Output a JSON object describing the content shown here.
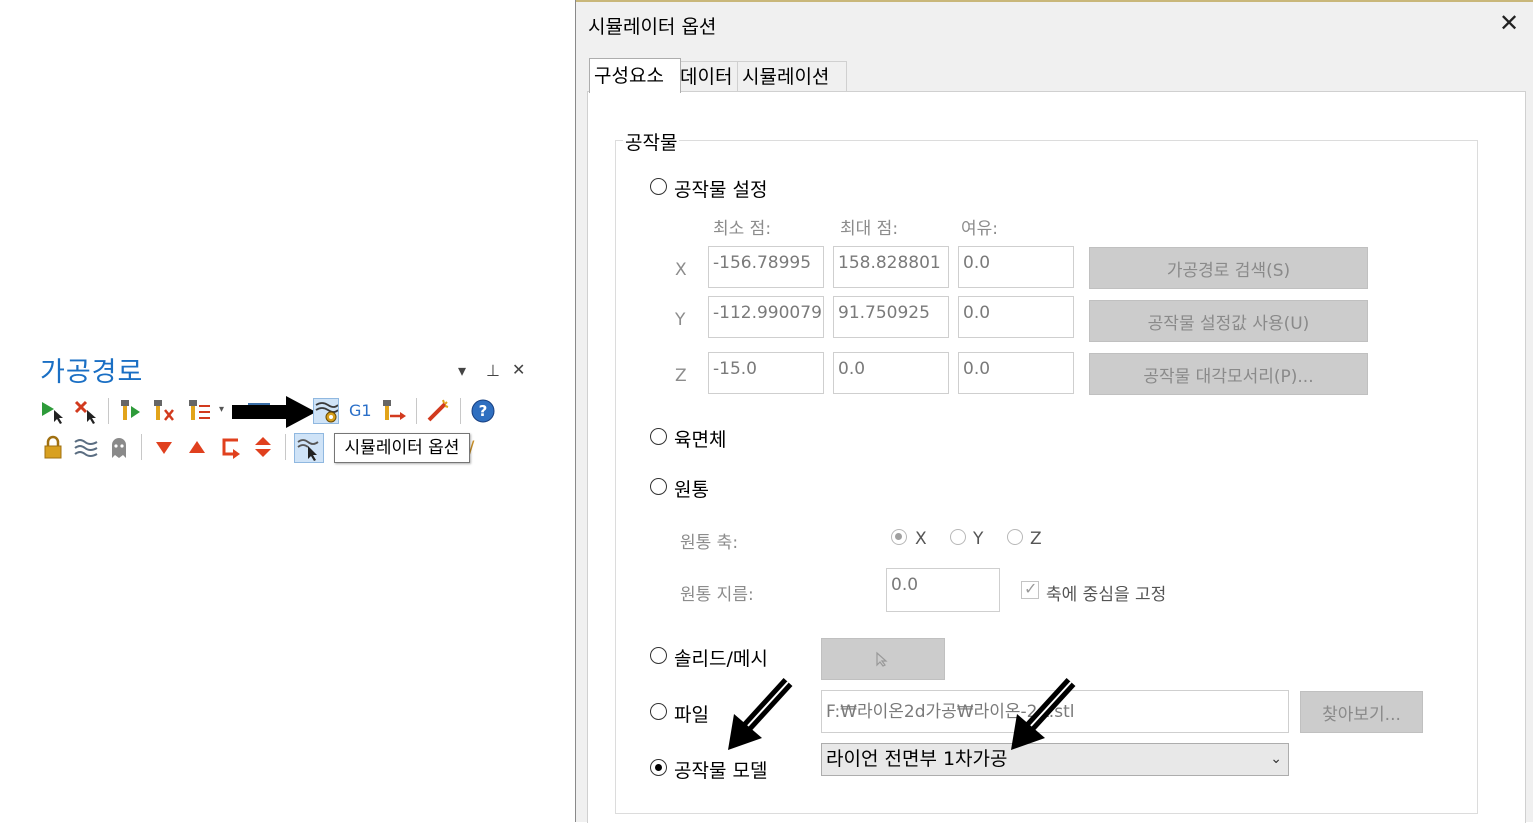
{
  "left_panel": {
    "title": "가공경로",
    "controls": {
      "dropdown": "▾",
      "pin": "⊥",
      "close": "✕"
    },
    "toolbar_g1_label": "G1",
    "tooltip": "시뮬레이터 옵션"
  },
  "dialog": {
    "title": "시뮬레이터 옵션",
    "close_glyph": "✕",
    "tabs": [
      {
        "label": "구성요소",
        "active": true
      },
      {
        "label": "데이터",
        "active": false
      },
      {
        "label": "시뮬레이션",
        "active": false
      }
    ],
    "group_label": "공작물",
    "options": {
      "stock_setting": "공작물 설정",
      "box": "육면체",
      "cylinder": "원통",
      "solid_mesh": "솔리드/메시",
      "file": "파일",
      "stock_model": "공작물 모델"
    },
    "selected_option": "stock_model",
    "column_headers": {
      "min": "최소 점:",
      "max": "최대 점:",
      "margin": "여유:"
    },
    "rows": [
      {
        "axis": "X",
        "min": "-156.78995",
        "max": "158.828801",
        "margin": "0.0"
      },
      {
        "axis": "Y",
        "min": "-112.990079",
        "max": "91.750925",
        "margin": "0.0"
      },
      {
        "axis": "Z",
        "min": "-15.0",
        "max": "0.0",
        "margin": "0.0"
      }
    ],
    "buttons": {
      "search_toolpath": "가공경로 검색(S)",
      "use_stock_settings": "공작물 설정값 사용(U)",
      "stock_diagonal": "공작물 대각모서리(P)...",
      "browse": "찾아보기..."
    },
    "cylinder": {
      "axis_label": "원통 축:",
      "axes": [
        "X",
        "Y",
        "Z"
      ],
      "selected_axis": "X",
      "diameter_label": "원통 지름:",
      "diameter_value": "0.0",
      "center_on_axis_label": "축에 중심을 고정",
      "center_on_axis_checked": true
    },
    "file_path": "F:₩라이온2d가공₩라이온-2A.stl",
    "stock_model_value": "라이언 전면부 1차가공",
    "combo_arrow": "⌄"
  }
}
